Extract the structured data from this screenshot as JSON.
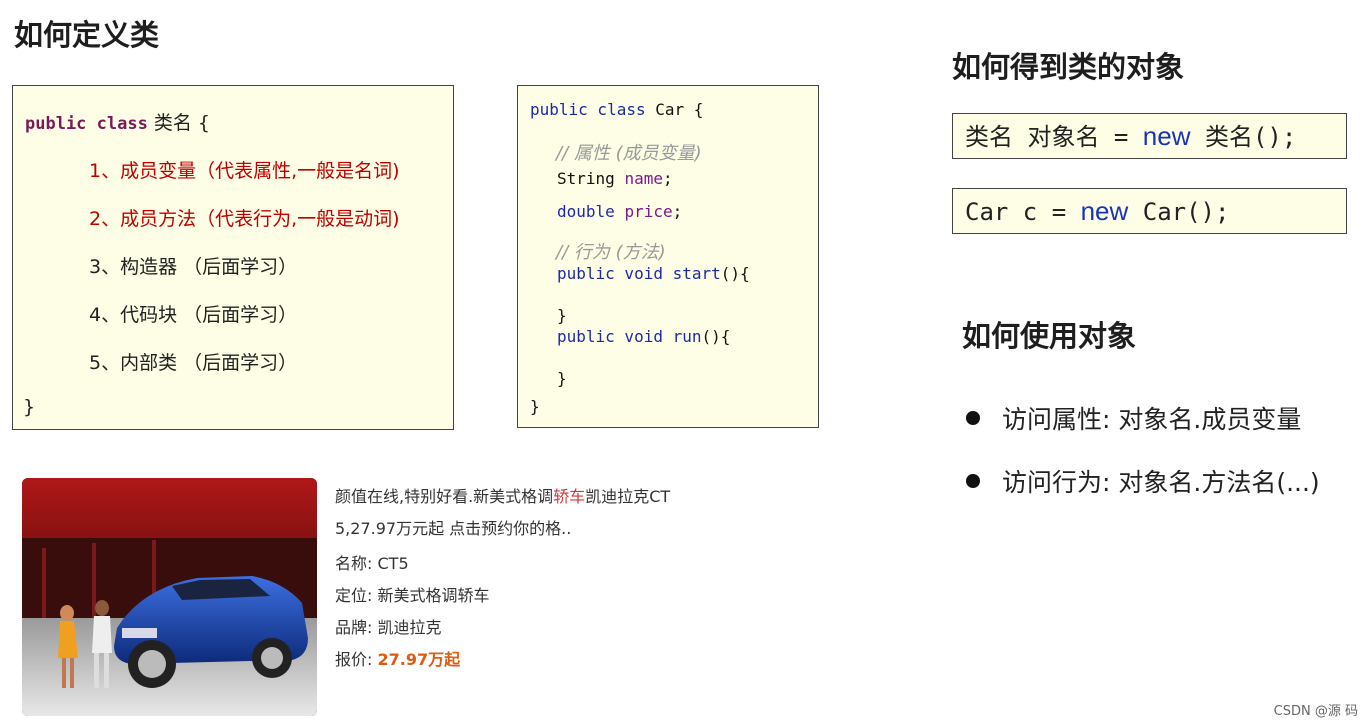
{
  "titles": {
    "define": "如何定义类",
    "get": "如何得到类的对象",
    "use": "如何使用对象"
  },
  "define_box": {
    "kw": "public class",
    "name": "类名 {",
    "items": [
      "1、成员变量（代表属性,一般是名词)",
      "2、成员方法（代表行为,一般是动词)",
      "3、构造器 （后面学习）",
      "4、代码块 （后面学习）",
      "5、内部类 （后面学习）"
    ],
    "close": "}"
  },
  "code_box": {
    "l1_kw": "public class",
    "l1_name": "Car {",
    "c1": "// 属性 (成员变量)",
    "l2_type": "String",
    "l2_var": "name",
    "l2_end": ";",
    "l3_type": "double",
    "l3_var": "price",
    "l3_end": ";",
    "c2": "// 行为 (方法)",
    "l4_kw": "public void",
    "l4_name": "start",
    "l4_end": "(){",
    "l5": "}",
    "l6_kw": "public void",
    "l6_name": "run",
    "l6_end": "(){",
    "l7": "}",
    "l8": "}"
  },
  "get_object": {
    "expr1_a": "类名  对象名 = ",
    "expr1_new": "new",
    "expr1_b": " 类名();",
    "expr2_a": "Car c = ",
    "expr2_new": "new",
    "expr2_b": " Car();"
  },
  "use_object": {
    "b1": "访问属性:  对象名.成员变量",
    "b2": "访问行为:  对象名.方法名(...)"
  },
  "car_ad": {
    "line1_a": "颜值在线,特别好看.新美式格调",
    "line1_hl": "轿车",
    "line1_b": "凯迪拉克CT",
    "line2": "5,27.97万元起 点击预约你的格..",
    "name_label": "名称:",
    "name_value": "CT5",
    "pos_label": "定位:",
    "pos_value": "新美式格调轿车",
    "brand_label": "品牌:",
    "brand_value": "凯迪拉克",
    "price_label": "报价:",
    "price_value": "27.97万起"
  },
  "footer": "CSDN @源  码",
  "colors": {
    "box_bg": "#fefee6",
    "keyword": "#7a1a5a",
    "red_text": "#c00000",
    "new_keyword": "#1a34b8",
    "price": "#e05a10"
  }
}
